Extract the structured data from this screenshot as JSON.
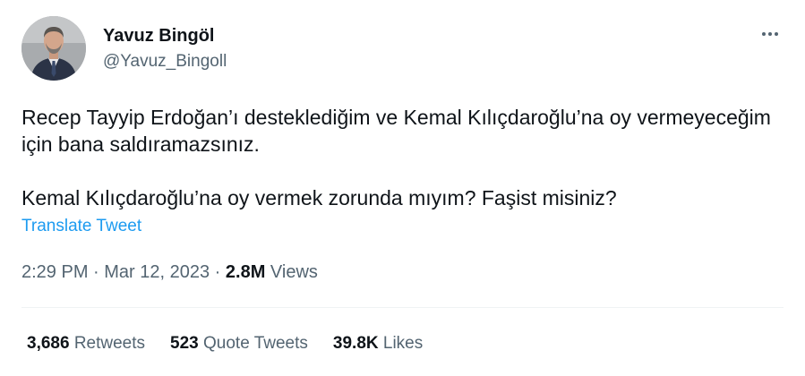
{
  "author": {
    "display_name": "Yavuz Bingöl",
    "handle": "@Yavuz_Bingoll"
  },
  "tweet": {
    "paragraph_1": "Recep Tayyip Erdoğan’ı desteklediğim ve Kemal Kılıçdaroğlu’na oy vermeyeceğim için bana saldıramazsınız.",
    "paragraph_2": "Kemal Kılıçdaroğlu’na oy vermek zorunda mıyım? Faşist misiniz?",
    "translate_label": "Translate Tweet"
  },
  "meta": {
    "time": "2:29 PM",
    "separator_1": " · ",
    "date": "Mar 12, 2023",
    "separator_2": " · ",
    "views_count": "2.8M",
    "views_label": " Views"
  },
  "stats": {
    "retweets_count": "3,686",
    "retweets_label": " Retweets",
    "quotes_count": "523",
    "quotes_label": " Quote Tweets",
    "likes_count": "39.8K",
    "likes_label": " Likes"
  },
  "colors": {
    "text_primary": "#0f1419",
    "text_secondary": "#536471",
    "link": "#1d9bf0",
    "divider": "#eff3f4"
  },
  "icons": {
    "more": "more-horizontal-icon"
  }
}
